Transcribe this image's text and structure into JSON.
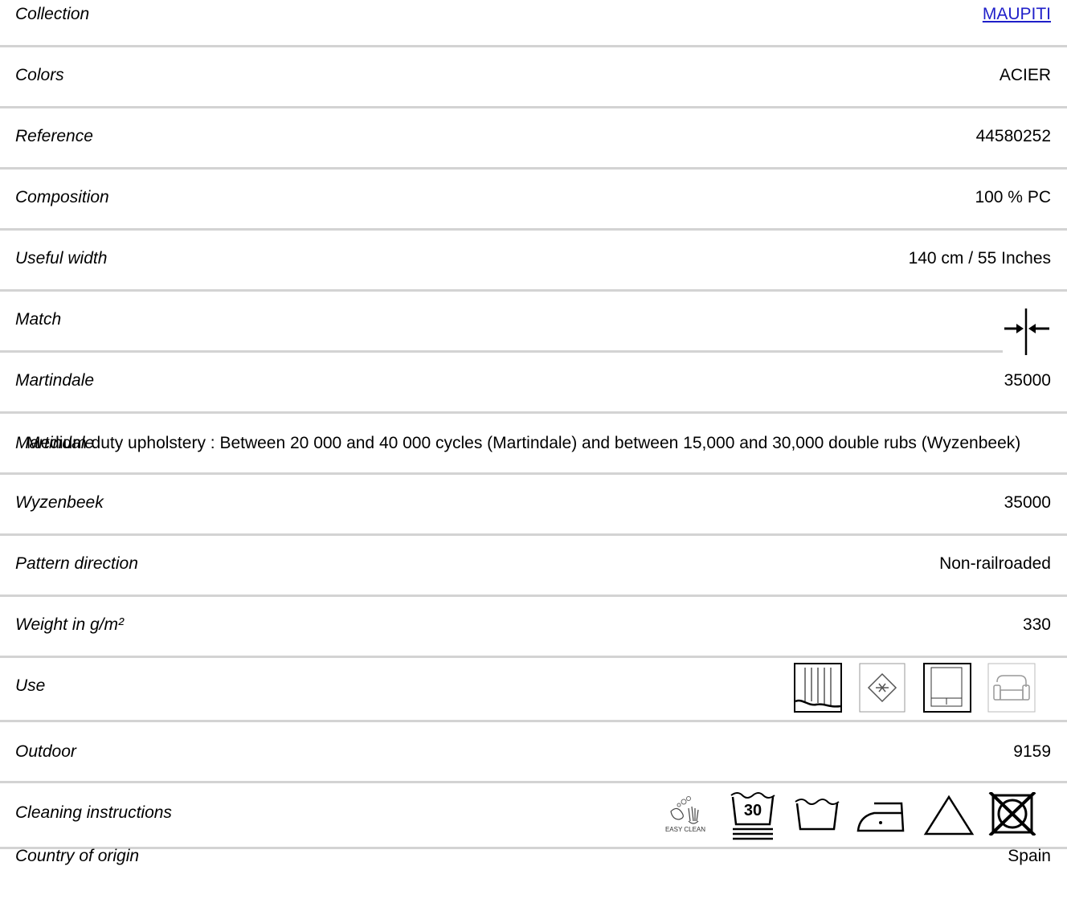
{
  "rows": [
    {
      "label": "Collection",
      "value": "MAUPITI"
    },
    {
      "label": "Colors",
      "value": "ACIER"
    },
    {
      "label": "Reference",
      "value": "44580252"
    },
    {
      "label": "Composition",
      "value": "100 % PC"
    },
    {
      "label": "Useful width",
      "value": "140 cm / 55 Inches"
    },
    {
      "label": "Match",
      "value": ""
    },
    {
      "label": "Martindale",
      "value": "35000"
    },
    {
      "label": "Martindale",
      "note": "Medium duty upholstery : Between 20 000 and 40 000 cycles (Martindale) and between 15,000 and 30,000 double rubs (Wyzenbeek)"
    },
    {
      "label": "Wyzenbeek",
      "value": "35000"
    },
    {
      "label": "Pattern direction",
      "value": "Non-railroaded"
    },
    {
      "label": "Weight in g/m²",
      "value": "330"
    },
    {
      "label": "Use",
      "value": ""
    },
    {
      "label": "Outdoor",
      "value": "9159"
    },
    {
      "label": "Cleaning instructions",
      "value": ""
    },
    {
      "label": "Country of origin",
      "value": "Spain"
    }
  ],
  "icons": {
    "match": "straight-match-icon",
    "use": [
      "curtain-icon",
      "fire-retardant-icon",
      "roller-blind-icon",
      "armchair-icon"
    ],
    "cleaning": [
      "easy-clean-icon",
      "wash-30-icon",
      "hand-wash-icon",
      "iron-low-icon",
      "bleach-allowed-icon",
      "no-tumble-dry-icon"
    ],
    "easy_clean_text": "EASY CLEAN",
    "wash_temp": "30"
  },
  "colors": {
    "link": "#1f1fc9",
    "divider": "#d3d3d3"
  }
}
